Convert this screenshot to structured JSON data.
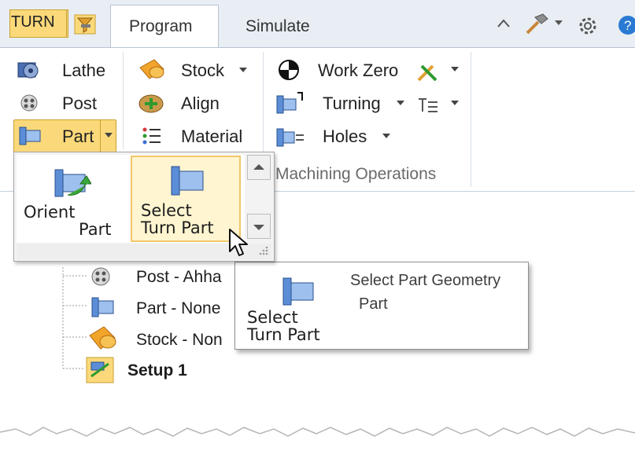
{
  "app": {
    "mode_button": "TURN",
    "filter_icon": "filter-icon"
  },
  "tabs": [
    {
      "label": "Program",
      "active": true
    },
    {
      "label": "Simulate",
      "active": false
    }
  ],
  "ribbon": {
    "col1": [
      {
        "label": "Lathe",
        "icon": "lathe-icon"
      },
      {
        "label": "Post",
        "icon": "post-icon"
      },
      {
        "label": "Part",
        "icon": "part-icon",
        "dropdown": true
      }
    ],
    "col2": [
      {
        "label": "Stock",
        "icon": "stock-icon",
        "dropdown": true
      },
      {
        "label": "Align",
        "icon": "align-icon"
      },
      {
        "label": "Material",
        "icon": "material-icon"
      }
    ],
    "col3": [
      {
        "label": "Work Zero",
        "icon": "work-zero-icon"
      },
      {
        "label": "Turning",
        "icon": "turning-icon",
        "dropdown": true
      },
      {
        "label": "Holes",
        "icon": "holes-icon",
        "dropdown": true
      }
    ],
    "group_label": "Machining Operations"
  },
  "dropdown": {
    "items": [
      {
        "line1": "Orient",
        "line2": "Part"
      },
      {
        "line1": "Select",
        "line2": "Turn Part"
      }
    ]
  },
  "tree": {
    "items": [
      "Post - Ahha",
      "Part - None",
      "Stock - Non"
    ],
    "setup": "Setup 1"
  },
  "tooltip": {
    "line1": "Select",
    "line2": "Turn Part",
    "title": "Select Part Geometry",
    "subtitle": "Part"
  },
  "colors": {
    "accent": "#fbd97a",
    "accent_border": "#c9a032",
    "part_blue": "#5b8ed6"
  }
}
